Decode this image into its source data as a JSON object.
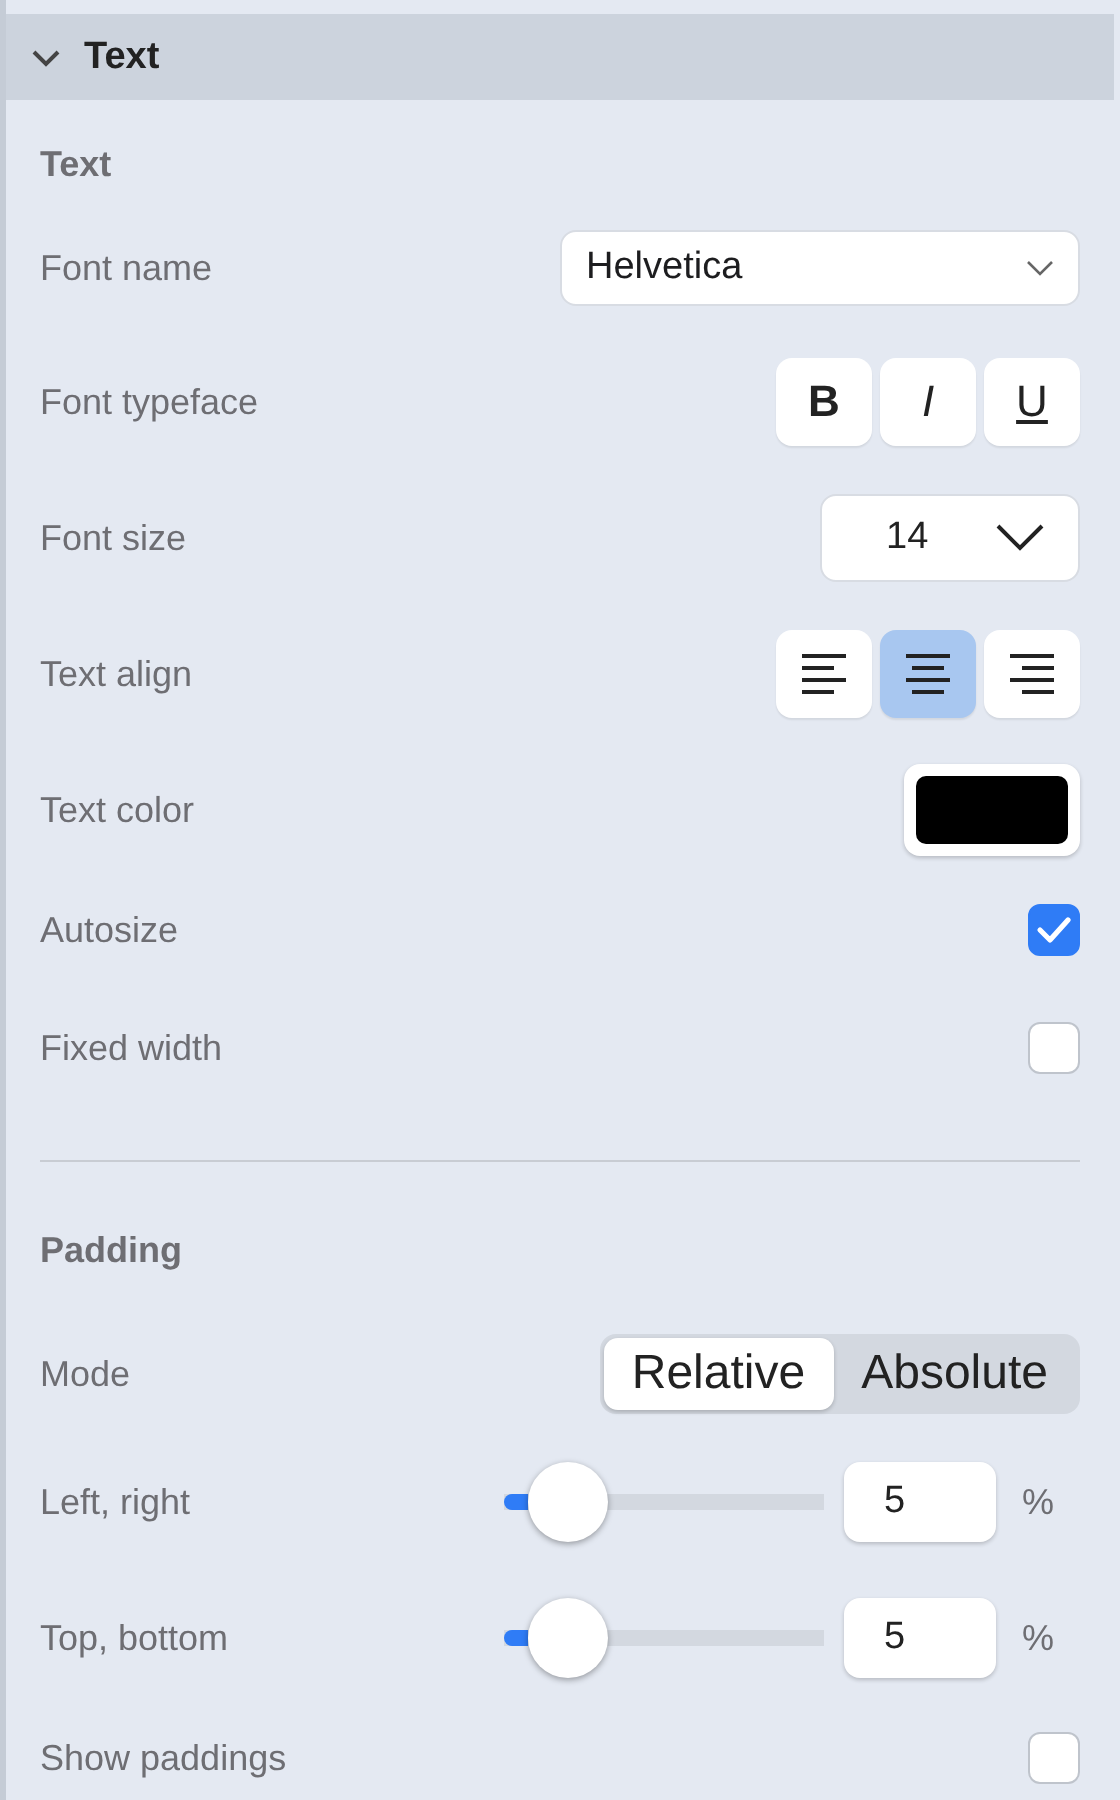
{
  "section": {
    "title": "Text",
    "expanded": true
  },
  "groups": [
    {
      "heading": "Text",
      "rows": [
        {
          "kind": "dropdown",
          "label": "Font name",
          "value": "Helvetica"
        },
        {
          "kind": "styles",
          "label": "Font typeface",
          "buttons": [
            {
              "text": "B",
              "selected": false
            },
            {
              "text": "I",
              "selected": false
            },
            {
              "text": "U",
              "selected": false
            }
          ]
        },
        {
          "kind": "stepper",
          "label": "Font size",
          "value": "14"
        },
        {
          "kind": "align",
          "label": "Text align",
          "options": [
            {
              "selected": false
            },
            {
              "selected": true
            },
            {
              "selected": false
            }
          ]
        },
        {
          "kind": "color",
          "label": "Text color",
          "color": "#000000"
        },
        {
          "kind": "checkbox",
          "label": "Autosize",
          "checked": true
        },
        {
          "kind": "checkbox",
          "label": "Fixed width",
          "checked": false
        }
      ]
    },
    {
      "heading": "Padding",
      "rows": [
        {
          "kind": "segmented",
          "label": "Mode",
          "options": [
            {
              "label": "Relative",
              "selected": true
            },
            {
              "label": "Absolute",
              "selected": false
            }
          ]
        },
        {
          "kind": "slider",
          "label": "Left, right",
          "level": 0.1,
          "value": "5",
          "unit": "%"
        },
        {
          "kind": "slider",
          "label": "Top, bottom",
          "level": 0.1,
          "value": "5",
          "unit": "%"
        },
        {
          "kind": "checkbox",
          "label": "Show paddings",
          "checked": false
        }
      ]
    }
  ]
}
